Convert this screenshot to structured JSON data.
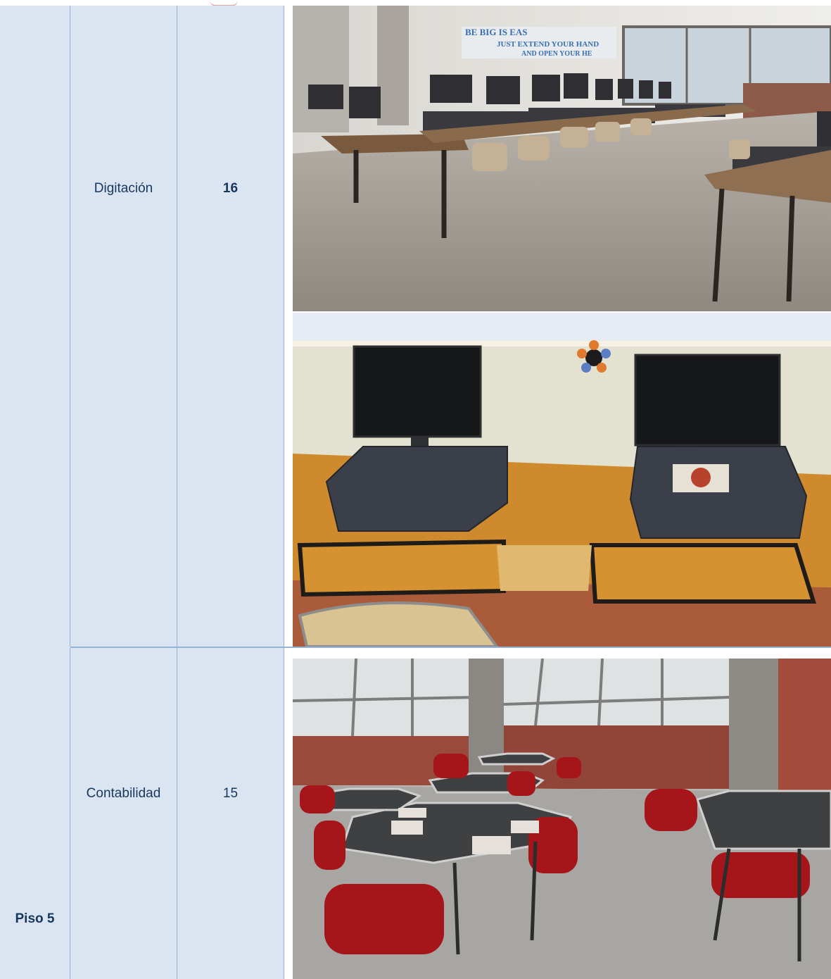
{
  "table": {
    "rows": [
      {
        "floor": "",
        "room": "Digitación",
        "count": "16",
        "photos": [
          "computer-lab-photo",
          "desktop-computers-photo"
        ]
      },
      {
        "floor": "Piso 5",
        "room": "Contabilidad",
        "count": "15",
        "photos": [
          "classroom-tables-chairs-photo"
        ]
      }
    ]
  },
  "photos": {
    "lab_banner_line1": "BE BIG IS EAS",
    "lab_banner_line2": "JUST EXTEND YOUR HAND",
    "lab_banner_line3": "AND OPEN YOUR HE"
  },
  "colors": {
    "cell_fill": "#dbe5f1",
    "border": "#95b3d7",
    "text": "#17365d"
  }
}
